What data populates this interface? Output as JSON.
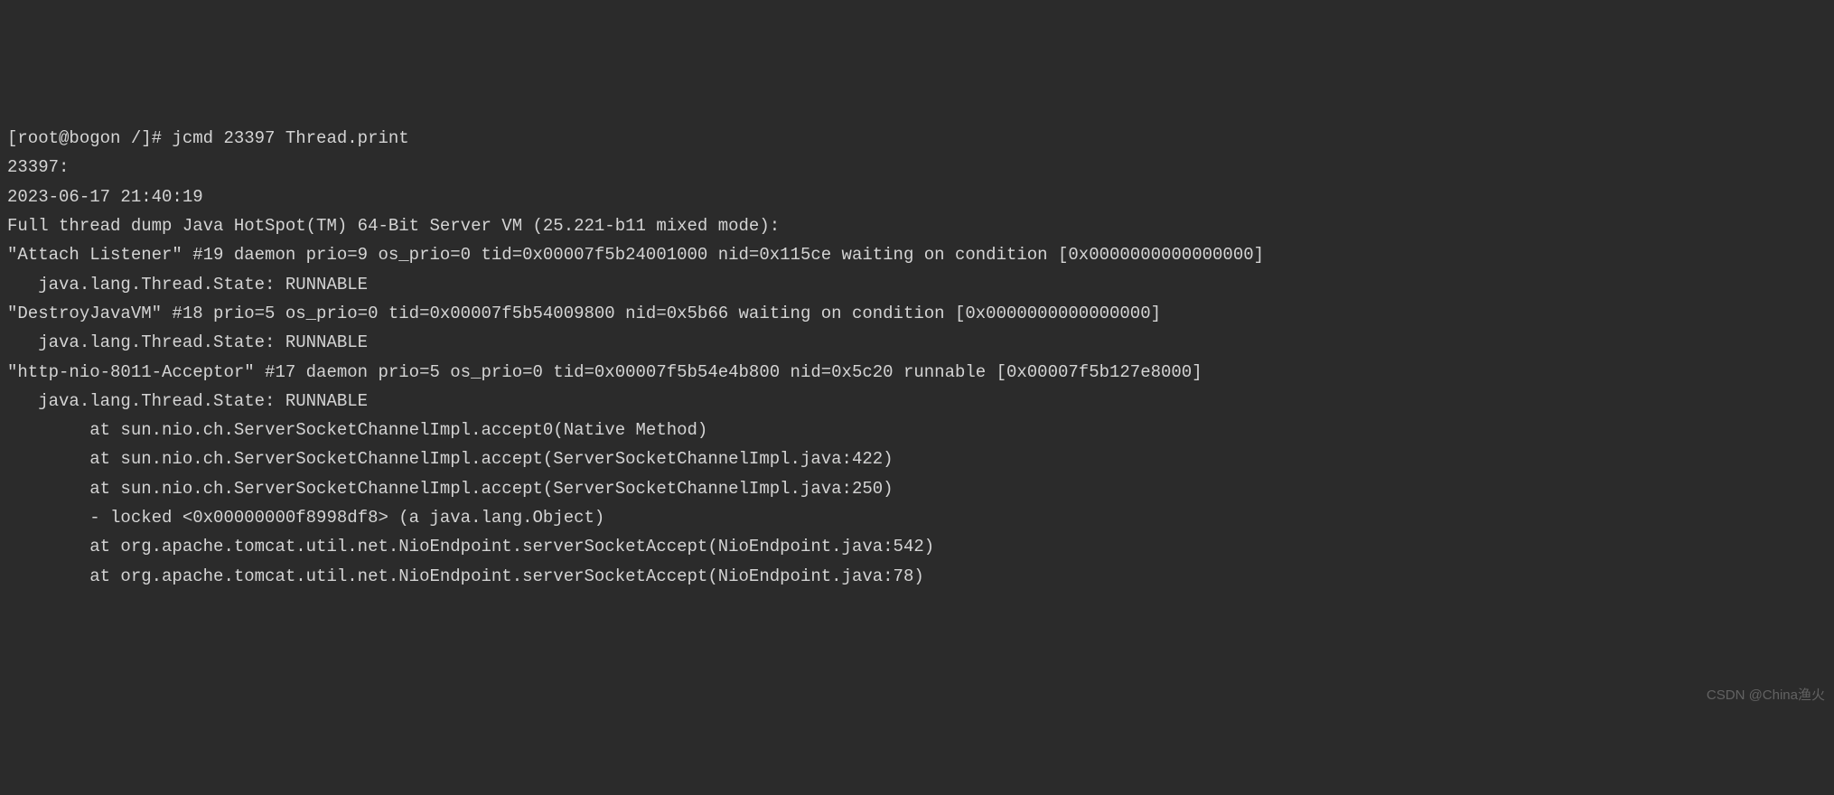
{
  "terminal": {
    "lines": [
      "[root@bogon /]# jcmd 23397 Thread.print",
      "23397:",
      "2023-06-17 21:40:19",
      "Full thread dump Java HotSpot(TM) 64-Bit Server VM (25.221-b11 mixed mode):",
      "",
      "\"Attach Listener\" #19 daemon prio=9 os_prio=0 tid=0x00007f5b24001000 nid=0x115ce waiting on condition [0x0000000000000000]",
      "   java.lang.Thread.State: RUNNABLE",
      "",
      "\"DestroyJavaVM\" #18 prio=5 os_prio=0 tid=0x00007f5b54009800 nid=0x5b66 waiting on condition [0x0000000000000000]",
      "   java.lang.Thread.State: RUNNABLE",
      "",
      "\"http-nio-8011-Acceptor\" #17 daemon prio=5 os_prio=0 tid=0x00007f5b54e4b800 nid=0x5c20 runnable [0x00007f5b127e8000]",
      "   java.lang.Thread.State: RUNNABLE",
      "        at sun.nio.ch.ServerSocketChannelImpl.accept0(Native Method)",
      "        at sun.nio.ch.ServerSocketChannelImpl.accept(ServerSocketChannelImpl.java:422)",
      "        at sun.nio.ch.ServerSocketChannelImpl.accept(ServerSocketChannelImpl.java:250)",
      "        - locked <0x00000000f8998df8> (a java.lang.Object)",
      "        at org.apache.tomcat.util.net.NioEndpoint.serverSocketAccept(NioEndpoint.java:542)",
      "        at org.apache.tomcat.util.net.NioEndpoint.serverSocketAccept(NioEndpoint.java:78)"
    ]
  },
  "watermark": "CSDN @China渔火"
}
